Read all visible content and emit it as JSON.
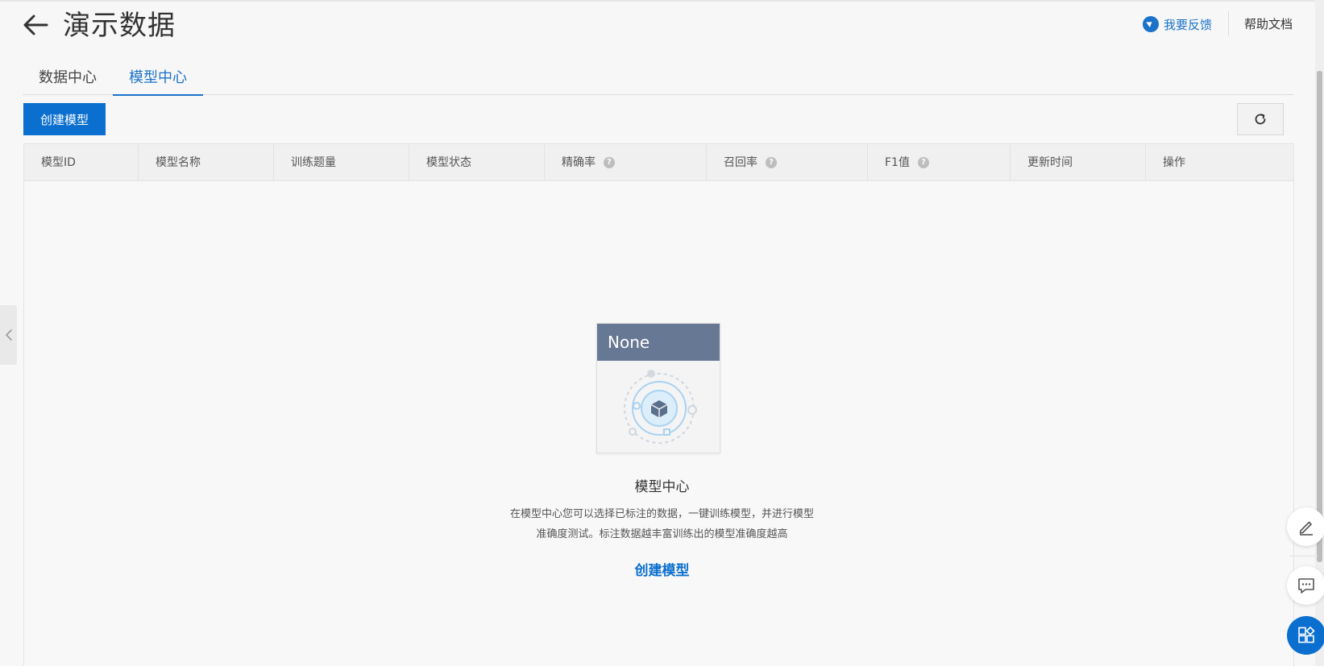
{
  "header": {
    "title": "演示数据",
    "feedback_label": "我要反馈",
    "help_label": "帮助文档"
  },
  "tabs": [
    {
      "label": "数据中心",
      "active": false
    },
    {
      "label": "模型中心",
      "active": true
    }
  ],
  "toolbar": {
    "create_label": "创建模型"
  },
  "table": {
    "columns": [
      {
        "label": "模型ID",
        "help": false
      },
      {
        "label": "模型名称",
        "help": false
      },
      {
        "label": "训练题量",
        "help": false
      },
      {
        "label": "模型状态",
        "help": false
      },
      {
        "label": "精确率",
        "help": true
      },
      {
        "label": "召回率",
        "help": true
      },
      {
        "label": "F1值",
        "help": true
      },
      {
        "label": "更新时间",
        "help": false
      },
      {
        "label": "操作",
        "help": false
      }
    ],
    "help_glyph": "?"
  },
  "empty": {
    "card_header": "None",
    "title": "模型中心",
    "desc_line1": "在模型中心您可以选择已标注的数据，一键训练模型，并进行模型",
    "desc_line2": "准确度测试。标注数据越丰富训练出的模型准确度越高",
    "link_label": "创建模型"
  },
  "colors": {
    "accent": "#0a6fcf",
    "card_header": "#677894"
  },
  "icons": [
    "back-arrow-icon",
    "feedback-icon",
    "refresh-icon",
    "chevron-left-icon",
    "edit-icon",
    "chat-icon",
    "apps-icon",
    "help-icon"
  ]
}
